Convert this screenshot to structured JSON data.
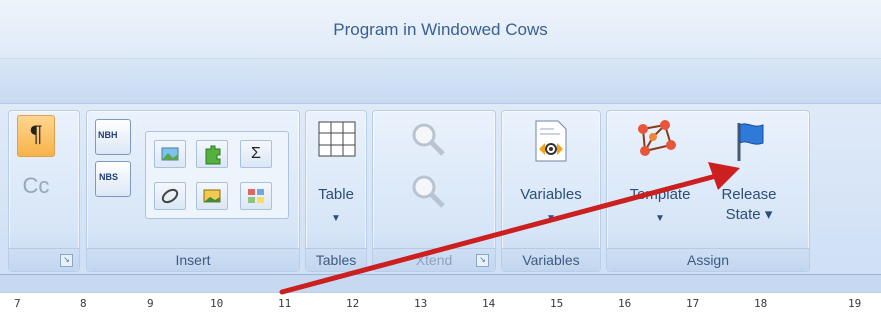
{
  "window": {
    "title": "Program in Windowed Cows"
  },
  "ribbon": {
    "paragraph_group": {
      "pilcrow_icon": "pilcrow-icon",
      "style_label": "Cc"
    },
    "insert_group": {
      "label": "Insert",
      "nbh_label": "NBH",
      "nbs_label": "NBS",
      "sigma_label": "Σ"
    },
    "tables_group": {
      "label": "Tables",
      "table_button": "Table"
    },
    "xtend_group": {
      "label": "Xtend"
    },
    "variables_group": {
      "label": "Variables",
      "variables_button": "Variables"
    },
    "assign_group": {
      "label": "Assign",
      "template_button": "Template",
      "release_button_line1": "Release",
      "release_button_line2": "State ▾"
    }
  },
  "ruler": {
    "marks": [
      "7",
      "8",
      "9",
      "10",
      "11",
      "12",
      "13",
      "14",
      "15",
      "16",
      "17",
      "18",
      "19"
    ]
  },
  "colors": {
    "accent": "#3a5f92",
    "arrow": "#cc1f1f",
    "highlight": "#f7b24a"
  }
}
